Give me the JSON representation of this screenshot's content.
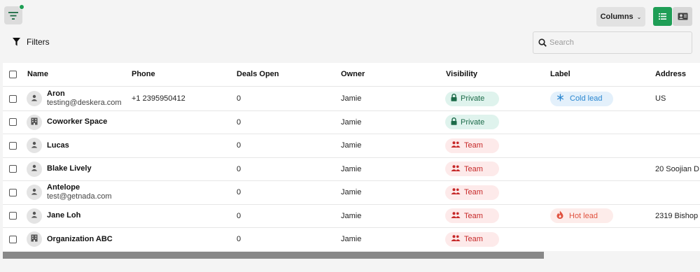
{
  "toolbar": {
    "columns_label": "Columns",
    "filters_label": "Filters",
    "search_placeholder": "Search"
  },
  "table": {
    "headers": [
      "Name",
      "Phone",
      "Deals Open",
      "Owner",
      "Visibility",
      "Label",
      "Address"
    ],
    "rows": [
      {
        "type": "person",
        "name": "Aron",
        "email": "testing@deskera.com",
        "phone": "+1 2395950412",
        "deals": "0",
        "owner": "Jamie",
        "visibility": "Private",
        "label": "Cold lead",
        "address": "US"
      },
      {
        "type": "org",
        "name": "Coworker Space",
        "email": "",
        "phone": "",
        "deals": "0",
        "owner": "Jamie",
        "visibility": "Private",
        "label": "",
        "address": ""
      },
      {
        "type": "person",
        "name": "Lucas",
        "email": "",
        "phone": "",
        "deals": "0",
        "owner": "Jamie",
        "visibility": "Team",
        "label": "",
        "address": ""
      },
      {
        "type": "person",
        "name": "Blake Lively",
        "email": "",
        "phone": "",
        "deals": "0",
        "owner": "Jamie",
        "visibility": "Team",
        "label": "",
        "address": "20 Soojian D"
      },
      {
        "type": "person",
        "name": "Antelope",
        "email": "test@getnada.com",
        "phone": "",
        "deals": "0",
        "owner": "Jamie",
        "visibility": "Team",
        "label": "",
        "address": ""
      },
      {
        "type": "person",
        "name": "Jane Loh",
        "email": "",
        "phone": "",
        "deals": "0",
        "owner": "Jamie",
        "visibility": "Team",
        "label": "Hot lead",
        "address": "2319 Bishop"
      },
      {
        "type": "org",
        "name": "Organization ABC",
        "email": "",
        "phone": "",
        "deals": "0",
        "owner": "Jamie",
        "visibility": "Team",
        "label": "",
        "address": ""
      }
    ]
  },
  "colors": {
    "accent_green": "#1f9e56",
    "private_bg": "#dff3ed",
    "team_bg": "#fdeaea",
    "cold_bg": "#e3f0fb",
    "hot_bg": "#fdecea"
  }
}
